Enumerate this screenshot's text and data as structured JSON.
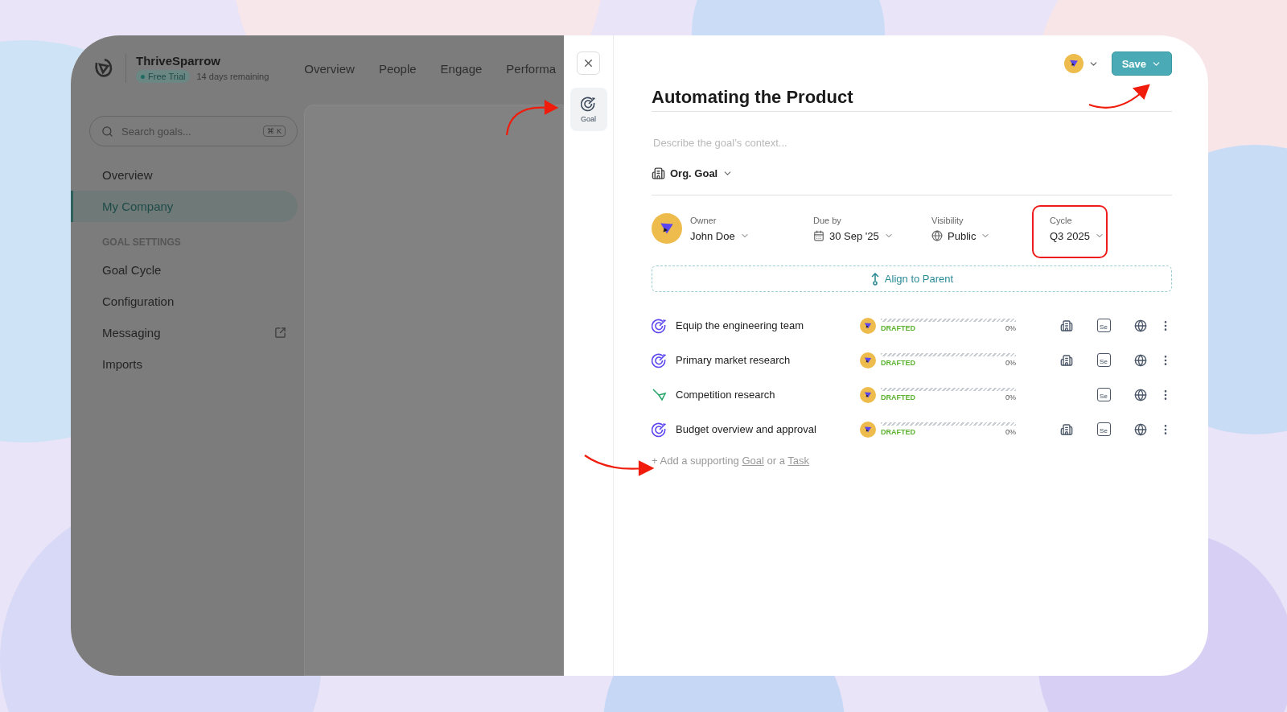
{
  "app": {
    "brand": "ThriveSparrow",
    "trial_badge": "Free Trial",
    "trial_note": "14 days remaining",
    "nav": [
      {
        "label": "Overview"
      },
      {
        "label": "People"
      },
      {
        "label": "Engage"
      },
      {
        "label": "Performa"
      }
    ]
  },
  "sidebar": {
    "search": {
      "placeholder": "Search goals...",
      "shortcut": "⌘ K"
    },
    "items": [
      {
        "label": "Overview",
        "selected": false
      },
      {
        "label": "My Company",
        "selected": true
      }
    ],
    "section_title": "GOAL SETTINGS",
    "settings": [
      {
        "label": "Goal Cycle",
        "external": false
      },
      {
        "label": "Configuration",
        "external": false
      },
      {
        "label": "Messaging",
        "external": true
      },
      {
        "label": "Imports",
        "external": false
      }
    ]
  },
  "panel": {
    "side_tabs": [
      {
        "label": "Goal",
        "selected": true
      }
    ],
    "save": "Save",
    "title": "Automating the Product",
    "description": {
      "placeholder": "Describe the goal’s context..."
    },
    "goal_type": "Org. Goal",
    "fields": [
      {
        "kind": "owner",
        "label": "Owner",
        "value": "John Doe",
        "highlighted": false
      },
      {
        "kind": "date",
        "label": "Due by",
        "value": "30 Sep '25",
        "highlighted": false
      },
      {
        "kind": "visibility",
        "label": "Visibility",
        "value": "Public",
        "highlighted": false
      },
      {
        "kind": "cycle",
        "label": "Cycle",
        "value": "Q3 2025",
        "highlighted": true
      }
    ],
    "align": "Align to Parent",
    "rows": [
      {
        "kind": "goal",
        "title": "Equip the engineering team",
        "status": "DRAFTED",
        "level": 0,
        "progress": "0%",
        "org": true,
        "date_abbr": "Se"
      },
      {
        "kind": "goal",
        "title": "Primary market research",
        "status": "DRAFTED",
        "level": 0,
        "progress": "0%",
        "org": true,
        "date_abbr": "Se"
      },
      {
        "kind": "task",
        "title": "Competition research",
        "status": "DRAFTED",
        "level": 0,
        "progress": "0%",
        "org": false,
        "date_abbr": "Se"
      },
      {
        "kind": "goal",
        "title": "Budget overview and approval",
        "status": "DRAFTED",
        "level": 0,
        "progress": "0%",
        "org": true,
        "date_abbr": "Se"
      }
    ],
    "add": {
      "prefix": "+ Add a supporting",
      "goal_link": "Goal",
      "middle": "or a",
      "task_link": "Task"
    }
  }
}
